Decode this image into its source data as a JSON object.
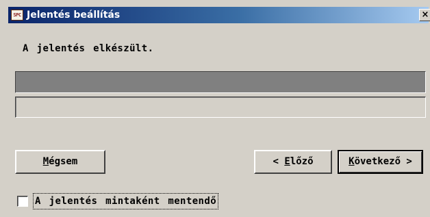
{
  "window": {
    "title": "Jelentés beállítás",
    "app_icon_text": "SPC",
    "close_glyph": "×"
  },
  "main": {
    "message": "A jelentés elkészült.",
    "progress_fraction": 1.0,
    "status_text": ""
  },
  "buttons": {
    "cancel": {
      "label": "Mégsem",
      "accelerator": "M"
    },
    "previous": {
      "label": "< Előző",
      "accelerator": "E"
    },
    "next": {
      "label": "Következő >",
      "accelerator": "K"
    }
  },
  "checkbox": {
    "label": "A jelentés mintaként mentendő",
    "checked": false
  },
  "colors": {
    "face": "#d4d0c8",
    "title_start": "#0a246a",
    "title_end": "#a6caf0",
    "progress_fill": "#808080"
  }
}
